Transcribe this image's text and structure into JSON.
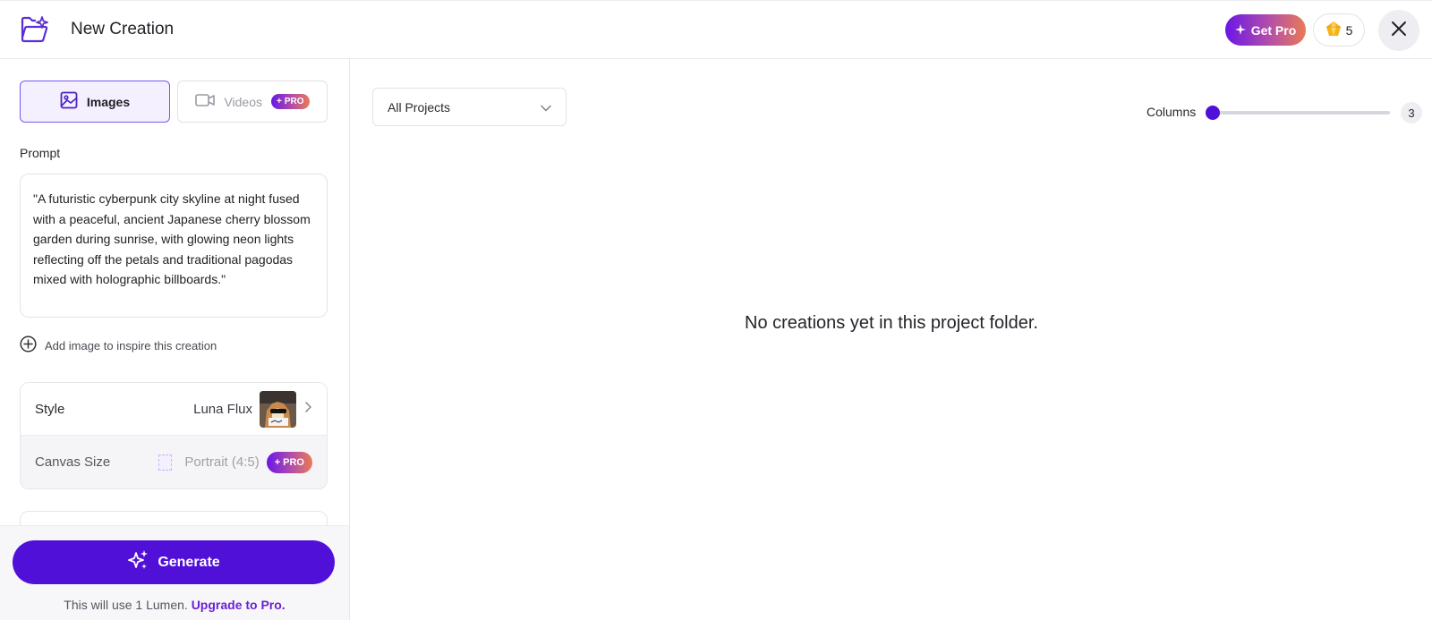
{
  "header": {
    "title": "New Creation",
    "get_pro_label": "Get Pro",
    "lumen_count": "5"
  },
  "sidebar": {
    "tabs": [
      {
        "label": "Images",
        "active": true
      },
      {
        "label": "Videos",
        "badge": "PRO"
      }
    ],
    "prompt_label": "Prompt",
    "prompt_text": "\"A futuristic cyberpunk city skyline at night fused with a peaceful, ancient Japanese cherry blossom garden during sunrise, with glowing neon lights reflecting off the petals and traditional pagodas mixed with holographic billboards.\"",
    "add_image_label": "Add image to inspire this creation",
    "settings": {
      "style_label": "Style",
      "style_value": "Luna Flux",
      "canvas_label": "Canvas Size",
      "canvas_value": "Portrait (4:5)",
      "canvas_badge": "PRO"
    },
    "generate_label": "Generate",
    "footer_note": "This will use 1 Lumen.",
    "upgrade_link": "Upgrade to Pro."
  },
  "main": {
    "project_select": "All Projects",
    "columns_label": "Columns",
    "columns_value": "3",
    "empty_message": "No creations yet in this project folder."
  },
  "colors": {
    "accent": "#5010d8",
    "pro_gradient_start": "#6a16e6",
    "pro_gradient_end": "#ea7a56"
  }
}
